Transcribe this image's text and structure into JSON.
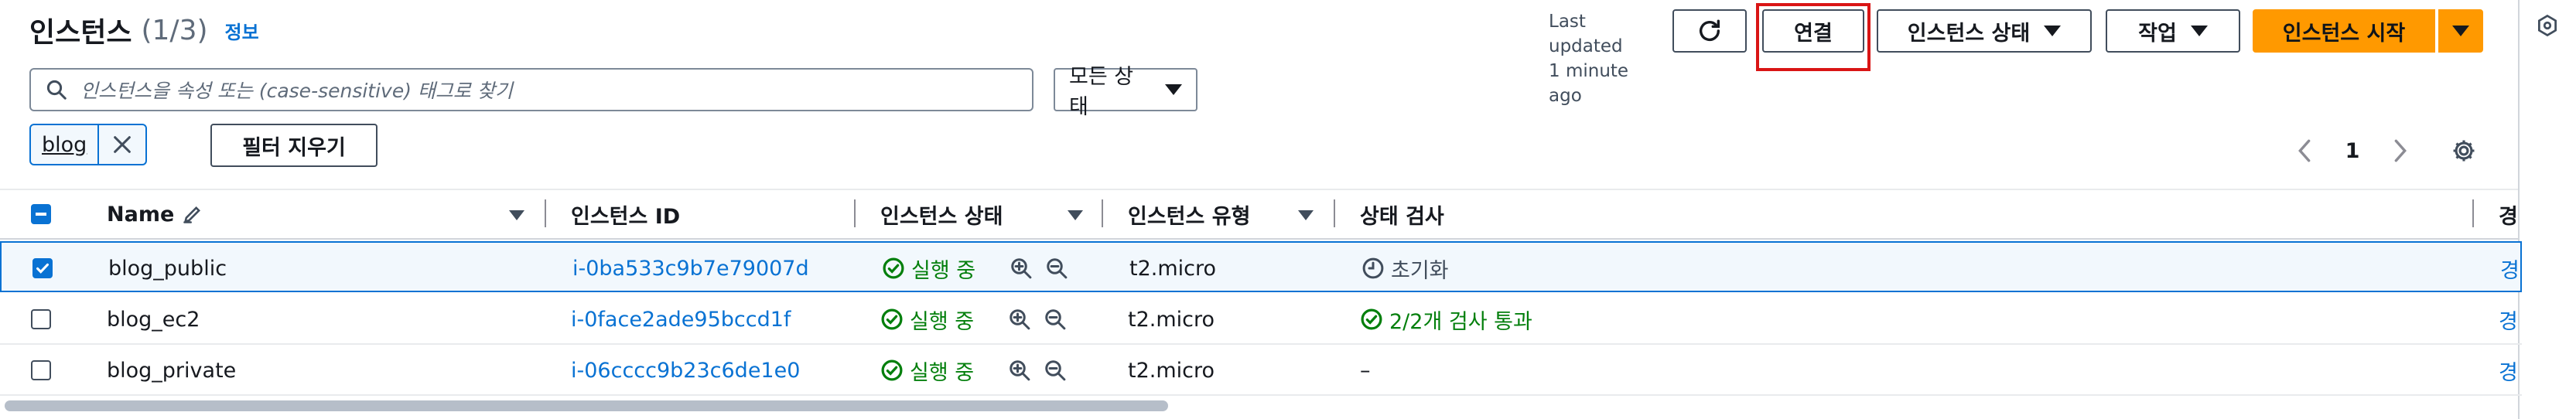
{
  "header": {
    "title": "인스턴스",
    "count": "(1/3)",
    "info_link": "정보",
    "last_updated_line1": "Last updated",
    "last_updated_line2": "1 minute ago"
  },
  "toolbar": {
    "refresh_icon": "refresh-icon",
    "connect_label": "연결",
    "instance_state_label": "인스턴스 상태",
    "actions_label": "작업",
    "launch_label": "인스턴스 시작"
  },
  "search": {
    "placeholder": "인스턴스을 속성 또는 (case-sensitive) 태그로 찾기",
    "state_filter": "모든 상태"
  },
  "filters": {
    "token": "blog",
    "clear_label": "필터 지우기"
  },
  "pagination": {
    "current_page": "1"
  },
  "table": {
    "headers": {
      "name": "Name",
      "instance_id": "인스턴스 ID",
      "instance_state": "인스턴스 상태",
      "instance_type": "인스턴스 유형",
      "status_check": "상태 검사",
      "alarm_partial": "경"
    },
    "rows": [
      {
        "name": "blog_public",
        "id": "i-0ba533c9b7e79007d",
        "state": "실행 중",
        "type": "t2.micro",
        "status": "초기화",
        "alarm": "경",
        "selected": true
      },
      {
        "name": "blog_ec2",
        "id": "i-0face2ade95bccd1f",
        "state": "실행 중",
        "type": "t2.micro",
        "status": "2/2개 검사 통과",
        "alarm": "경",
        "selected": false
      },
      {
        "name": "blog_private",
        "id": "i-06cccc9b23c6de1e0",
        "state": "실행 중",
        "type": "t2.micro",
        "status": "–",
        "alarm": "경",
        "selected": false
      }
    ]
  },
  "colors": {
    "primary": "#ff9900",
    "link": "#0972d3",
    "success": "#037f0c",
    "highlight_box": "#d91515",
    "selected_row": "#f2f8fd"
  }
}
